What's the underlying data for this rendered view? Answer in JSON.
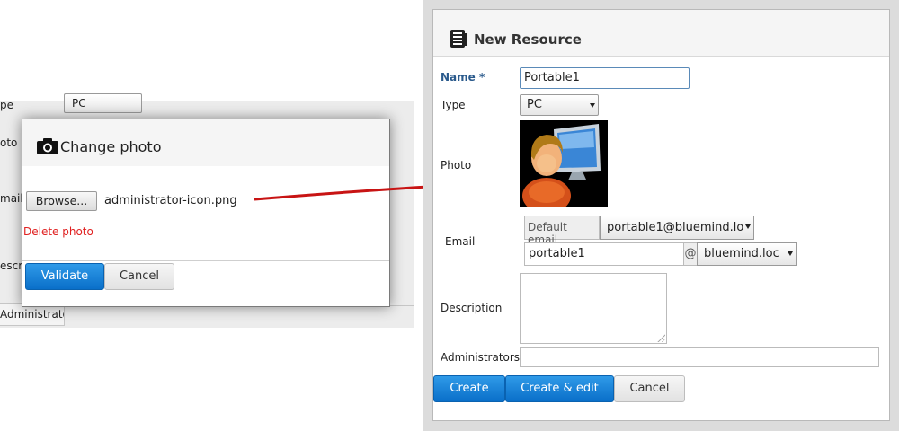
{
  "background_form": {
    "labels": [
      "pe",
      "oto",
      "mail",
      "escrip"
    ],
    "type_value": "PC",
    "tab_label": "Administrators"
  },
  "change_photo_dialog": {
    "title": "Change photo",
    "browse_label": "Browse...",
    "file_name": "administrator-icon.png",
    "delete_label": "Delete photo",
    "validate_label": "Validate",
    "cancel_label": "Cancel"
  },
  "new_resource_dialog": {
    "title": "New Resource",
    "fields": {
      "name_label": "Name *",
      "name_value": "Portable1",
      "type_label": "Type",
      "type_value": "PC",
      "photo_label": "Photo",
      "email_label": "Email",
      "email_default_label": "Default email",
      "email_default_value": "portable1@bluemind.lo",
      "email_local_value": "portable1",
      "email_at": "@",
      "email_domain_value": "bluemind.loc",
      "description_label": "Description",
      "administrators_label": "Administrators"
    },
    "buttons": {
      "create_label": "Create",
      "create_edit_label": "Create & edit",
      "cancel_label": "Cancel"
    }
  },
  "colors": {
    "primary_button": "#1a82d8",
    "arrow": "#c81414",
    "delete_link": "#e02020",
    "required_label": "#2a5a8c"
  },
  "icons": [
    "camera-icon",
    "resource-icon",
    "administrator-avatar",
    "red-arrow"
  ]
}
